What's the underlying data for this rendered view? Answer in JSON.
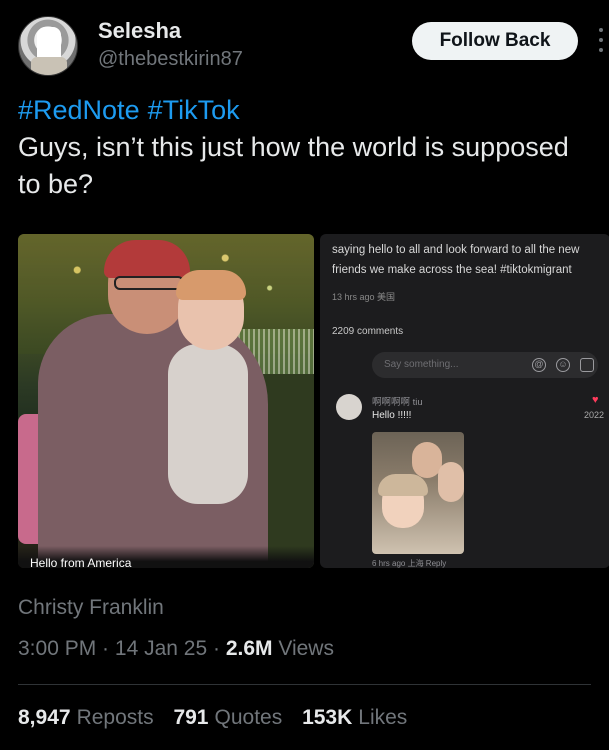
{
  "author": {
    "name": "Selesha",
    "handle": "@thebestkirin87",
    "follow_label": "Follow Back"
  },
  "tweet": {
    "hashtags": [
      "#RedNote",
      "#TikTok"
    ],
    "text": "Guys, isn’t this just how the world is supposed to be?"
  },
  "media": {
    "left_caption": "Hello from America",
    "right": {
      "top_cut_text": "...",
      "post_text": "saying hello to all and look forward to all the new friends we make across the sea! #tiktokmigrant",
      "meta": "13 hrs ago 美国",
      "comments_count": "2209 comments",
      "input_placeholder": "Say something...",
      "comment_author": "啊啊啊啊 tiu",
      "comment_text": "Hello !!!!!",
      "comment_like_count": "2022",
      "reply_meta": "6 hrs ago 上海 Reply"
    }
  },
  "signature": "Christy Franklin",
  "timestamp": {
    "time": "3:00 PM",
    "sep1": " · ",
    "date": "14 Jan 25",
    "sep2": " · ",
    "views_count": "2.6M",
    "views_label": " Views"
  },
  "stats": {
    "reposts_count": "8,947",
    "reposts_label": "Reposts",
    "quotes_count": "791",
    "quotes_label": "Quotes",
    "likes_count": "153K",
    "likes_label": "Likes"
  },
  "colors": {
    "background": "#000000",
    "link": "#1d9bf0",
    "muted": "#71767b",
    "text": "#e7e9ea"
  }
}
